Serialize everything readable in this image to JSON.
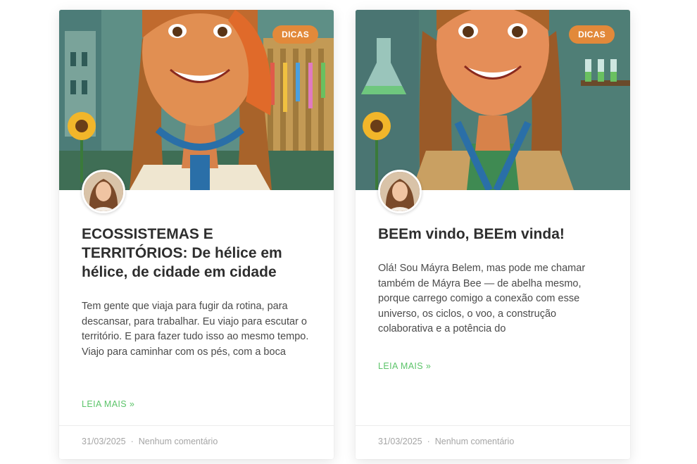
{
  "posts": [
    {
      "category": "DICAS",
      "title": "ECOSSISTEMAS E TERRITÓRIOS: De hélice em hélice, de cidade em cidade",
      "excerpt": "Tem gente que viaja para fugir da rotina, para descansar, para trabalhar. Eu viajo para escutar o território. E para fazer tudo isso ao mesmo tempo. Viajo para caminhar com os pés, com a boca",
      "read_more": "LEIA MAIS »",
      "date": "31/03/2025",
      "separator": "·",
      "comments": "Nenhum comentário"
    },
    {
      "category": "DICAS",
      "title": "BEEm vindo, BEEm vinda!",
      "excerpt": "Olá! Sou Máyra Belem, mas pode me chamar também de Máyra Bee — de abelha mesmo, porque carrego comigo a conexão com esse universo, os ciclos, o voo, a construção colaborativa e a potência do",
      "read_more": "LEIA MAIS »",
      "date": "31/03/2025",
      "separator": "·",
      "comments": "Nenhum comentário"
    }
  ],
  "colors": {
    "badge": "#e2893a",
    "read_more": "#5cc46a",
    "meta": "#a5a5a5"
  }
}
